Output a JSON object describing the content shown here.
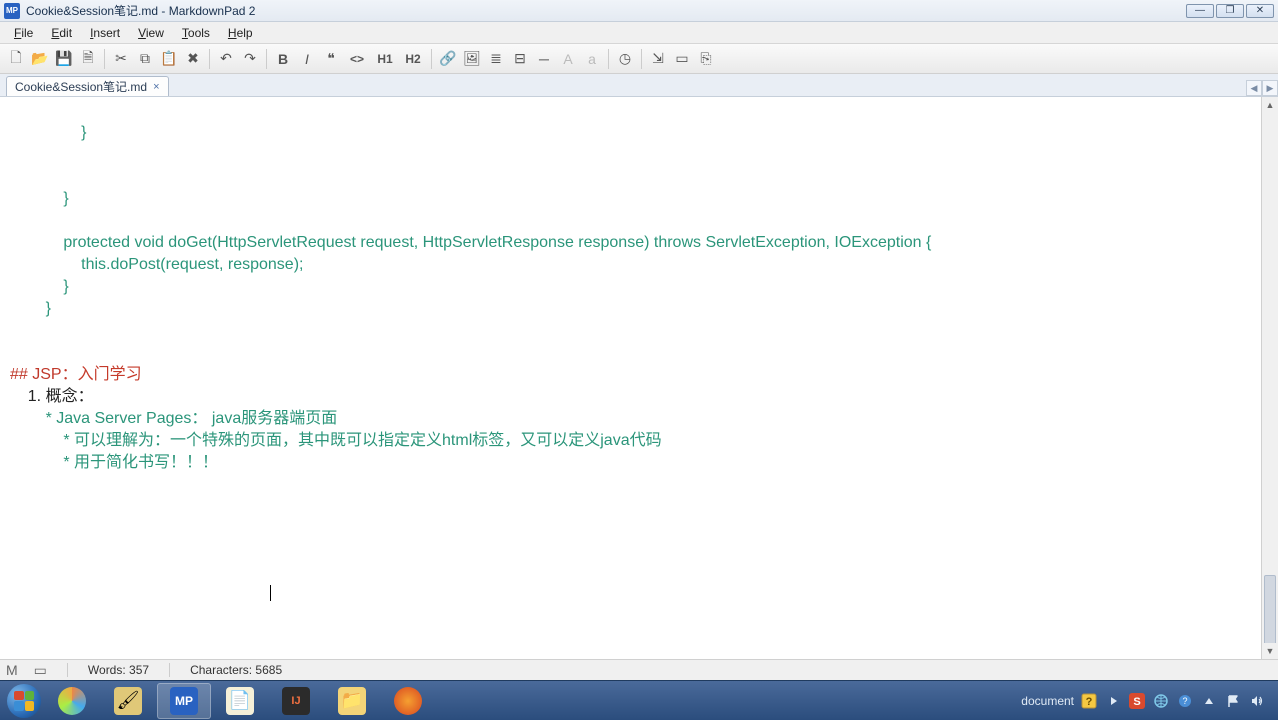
{
  "window": {
    "app_icon": "MP",
    "title": "Cookie&Session笔记.md - MarkdownPad 2",
    "min_label": "—",
    "max_label": "❐",
    "close_label": "✕"
  },
  "menu": {
    "file": "File",
    "edit": "Edit",
    "insert": "Insert",
    "view": "View",
    "tools": "Tools",
    "help": "Help"
  },
  "toolbar": {
    "new": "🗋",
    "open": "📂",
    "save": "💾",
    "save_all": "🗎",
    "cut": "✂",
    "copy": "⧉",
    "paste": "📋",
    "delete": "✖",
    "undo": "↶",
    "redo": "↷",
    "bold": "B",
    "italic": "I",
    "quote": "❝",
    "code": "<>",
    "h1": "H1",
    "h2": "H2",
    "link": "🔗",
    "image": "🖼",
    "ul": "≣",
    "ol": "⊟",
    "hr": "─",
    "a_upper": "A",
    "a_lower": "a",
    "time": "◷",
    "export": "⇲",
    "preview": "▭",
    "browser": "⎘"
  },
  "tab": {
    "name": "Cookie&Session笔记.md",
    "close": "×",
    "nav_left": "◀",
    "nav_right": "▶"
  },
  "editor": {
    "line1": "                }",
    "line2": "",
    "line3": "",
    "line4": "            }",
    "line5": "",
    "line6_a": "            ",
    "line6_b": "protected void doGet(HttpServletRequest request, HttpServletResponse response) throws ServletException, IOException {",
    "line7_a": "                ",
    "line7_b": "this.doPost(request, response);",
    "line8": "            }",
    "line9": "        }",
    "line10": "",
    "line11": "",
    "line12_a": "## JSP：",
    "line12_b": "入门学习",
    "line13_a": "    1. ",
    "line13_b": "概念：",
    "line14_a": "        * ",
    "line14_b": "Java Server Pages： java服务器端页面",
    "line15_a": "            * ",
    "line15_b": "可以理解为：一个特殊的页面，其中既可以指定定义html标签，又可以定义java代码",
    "line16_a": "            * ",
    "line16_b": "用于简化书写！！！"
  },
  "statusbar": {
    "words": "Words: 357",
    "chars": "Characters: 5685"
  },
  "taskbar": {
    "tray_doc": "document"
  }
}
